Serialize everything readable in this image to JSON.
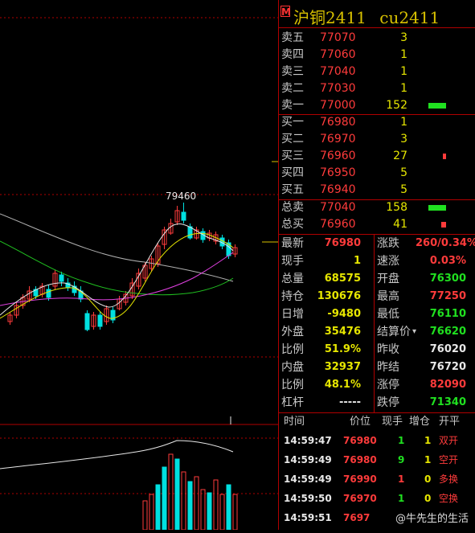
{
  "title": {
    "badge": "M",
    "name": "沪铜2411",
    "code": "cu2411"
  },
  "chart": {
    "high_label": "79460",
    "colors": {
      "up": "#ff3b3b",
      "down": "#00e0e0",
      "ma1": "#e8e8e8",
      "ma2": "#e6e600",
      "ma3": "#e040e0",
      "ma4": "#20c020",
      "ma5": "#b0b0b0",
      "grid": "#b00000"
    }
  },
  "order_book": {
    "asks": [
      {
        "label": "卖五",
        "price": "77070",
        "vol": "3",
        "bar": 0
      },
      {
        "label": "卖四",
        "price": "77060",
        "vol": "1",
        "bar": 0
      },
      {
        "label": "卖三",
        "price": "77040",
        "vol": "1",
        "bar": 0
      },
      {
        "label": "卖二",
        "price": "77030",
        "vol": "1",
        "bar": 0
      },
      {
        "label": "卖一",
        "price": "77000",
        "vol": "152",
        "bar": 1
      }
    ],
    "bids": [
      {
        "label": "买一",
        "price": "76980",
        "vol": "1",
        "bar": 0
      },
      {
        "label": "买二",
        "price": "76970",
        "vol": "3",
        "bar": 0
      },
      {
        "label": "买三",
        "price": "76960",
        "vol": "27",
        "bar": 0.18
      },
      {
        "label": "买四",
        "price": "76950",
        "vol": "5",
        "bar": 0
      },
      {
        "label": "买五",
        "price": "76940",
        "vol": "5",
        "bar": 0
      }
    ],
    "totals": [
      {
        "label": "总卖",
        "price": "77040",
        "vol": "158",
        "bar": 1,
        "color": "#20e020"
      },
      {
        "label": "总买",
        "price": "76960",
        "vol": "41",
        "bar": 0.26,
        "color": "#ff3b3b"
      }
    ]
  },
  "stats": [
    {
      "l1": "最新",
      "v1": "76980",
      "c1": "red",
      "l2": "涨跌",
      "v2": "260/0.34%",
      "c2": "red"
    },
    {
      "l1": "现手",
      "v1": "1",
      "c1": "yel",
      "l2": "速涨",
      "v2": "0.03%",
      "c2": "red"
    },
    {
      "l1": "总量",
      "v1": "68575",
      "c1": "yel",
      "l2": "开盘",
      "v2": "76300",
      "c2": "grn"
    },
    {
      "l1": "持仓",
      "v1": "130676",
      "c1": "yel",
      "l2": "最高",
      "v2": "77250",
      "c2": "red"
    },
    {
      "l1": "日增",
      "v1": "-9480",
      "c1": "yel",
      "l2": "最低",
      "v2": "76110",
      "c2": "grn"
    },
    {
      "l1": "外盘",
      "v1": "35476",
      "c1": "yel",
      "l2": "结算价",
      "v2": "76620",
      "c2": "grn"
    },
    {
      "l1": "比例",
      "v1": "51.9%",
      "c1": "yel",
      "l2": "昨收",
      "v2": "76020",
      "c2": "wht"
    },
    {
      "l1": "内盘",
      "v1": "32937",
      "c1": "yel",
      "l2": "昨结",
      "v2": "76720",
      "c2": "wht"
    },
    {
      "l1": "比例",
      "v1": "48.1%",
      "c1": "yel",
      "l2": "涨停",
      "v2": "82090",
      "c2": "red"
    },
    {
      "l1": "杠杆",
      "v1": "-----",
      "c1": "wht",
      "l2": "跌停",
      "v2": "71340",
      "c2": "grn"
    }
  ],
  "ticks": {
    "headers": {
      "time": "时间",
      "price": "价位",
      "hand": "现手",
      "pos": "增仓",
      "type": "开平"
    },
    "rows": [
      {
        "time": "14:59:47",
        "price": "76980",
        "hand": "1",
        "hand_color": "grn",
        "pos": "1",
        "type": "双开"
      },
      {
        "time": "14:59:49",
        "price": "76980",
        "hand": "9",
        "hand_color": "grn",
        "pos": "1",
        "type": "空开"
      },
      {
        "time": "14:59:49",
        "price": "76990",
        "hand": "1",
        "hand_color": "red",
        "pos": "0",
        "type": "多换"
      },
      {
        "time": "14:59:50",
        "price": "76970",
        "hand": "1",
        "hand_color": "grn",
        "pos": "0",
        "type": "空换"
      },
      {
        "time": "14:59:51",
        "price": "7697",
        "hand": "",
        "hand_color": "grn",
        "pos": "",
        "type": ""
      }
    ]
  },
  "watermark": "@牛先生的生活"
}
